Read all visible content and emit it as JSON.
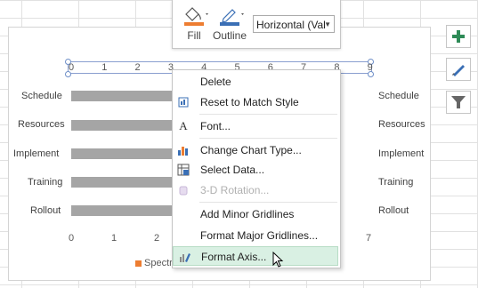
{
  "mini_toolbar": {
    "fill_label": "Fill",
    "outline_label": "Outline",
    "element_selector": "Horizontal (Val"
  },
  "context_menu": {
    "items": [
      {
        "label": "Delete",
        "icon": "none"
      },
      {
        "label": "Reset to Match Style",
        "icon": "reset-style-icon"
      },
      {
        "label": "Font...",
        "icon": "font-icon"
      },
      {
        "label": "Change Chart Type...",
        "icon": "chart-type-icon"
      },
      {
        "label": "Select Data...",
        "icon": "select-data-icon"
      },
      {
        "label": "3-D Rotation...",
        "icon": "3d-rotation-icon",
        "disabled": true
      },
      {
        "label": "Add Minor Gridlines",
        "icon": "none"
      },
      {
        "label": "Format Major Gridlines...",
        "icon": "none"
      },
      {
        "label": "Format Axis...",
        "icon": "format-axis-icon",
        "highlighted": true
      }
    ]
  },
  "chart_data": {
    "type": "bar",
    "categories": [
      "Schedule",
      "Resources",
      "Implement",
      "Training",
      "Rollout"
    ],
    "top_axis_ticks": [
      "0",
      "1",
      "2",
      "3",
      "4",
      "5",
      "6",
      "7",
      "8",
      "9"
    ],
    "bottom_axis_ticks": [
      "0",
      "1",
      "2",
      "7"
    ],
    "legend_text": "Spectr",
    "colors": {
      "bar": "#a5a5a5",
      "legend": "#ed7d31"
    }
  },
  "side_buttons": [
    "add-chart-element-icon",
    "chart-styles-icon",
    "chart-filters-icon"
  ]
}
